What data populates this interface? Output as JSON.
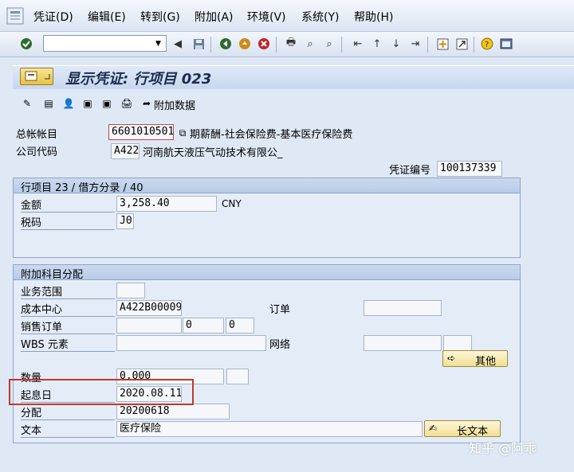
{
  "menu": {
    "items": [
      "凭证(D)",
      "编辑(E)",
      "转到(G)",
      "附加(A)",
      "环境(V)",
      "系统(Y)",
      "帮助(H)"
    ]
  },
  "toolbar": {
    "command_field": "",
    "icons": [
      "enter-icon",
      "back-icon",
      "exit-icon",
      "cancel-icon",
      "print-icon",
      "find-icon",
      "find-next-icon",
      "first-page-icon",
      "previous-page-icon",
      "next-page-icon",
      "last-page-icon",
      "create-session-icon",
      "shortcut-icon",
      "help-icon",
      "layout-icon"
    ]
  },
  "title": "显示凭证: 行项目 023",
  "app_toolbar": {
    "extra_data_label": "附加数据"
  },
  "header": {
    "gl_account_label": "总帐帐目",
    "gl_account_value": "6601010501",
    "gl_account_desc": "期薪酬-社会保险费-基本医疗保险费",
    "company_code_label": "公司代码",
    "company_code_value": "A422",
    "company_name": "河南航天液压气动技术有限公_",
    "doc_number_label": "凭证编号",
    "doc_number_value": "100137339"
  },
  "line_item": {
    "title": "行项目 23 / 借方分录 / 40",
    "amount_label": "金额",
    "amount_value": "3,258.40",
    "currency": "CNY",
    "tax_code_label": "税码",
    "tax_code_value": "J0"
  },
  "assignment": {
    "title": "附加科目分配",
    "business_area_label": "业务范围",
    "business_area_value": "",
    "cost_center_label": "成本中心",
    "cost_center_value": "A422B00009",
    "order_label": "订单",
    "order_value": "",
    "sales_order_label": "销售订单",
    "sales_order_value": "",
    "sales_order_item": "0",
    "sales_order_schedule": "0",
    "wbs_label": "WBS 元素",
    "wbs_value": "",
    "network_label": "网络",
    "network_value": "",
    "network_op": "",
    "more_button": "其他",
    "quantity_label": "数量",
    "quantity_value": "0.000",
    "quantity_unit": "",
    "value_date_label": "起息日",
    "value_date_value": "2020.08.11",
    "assignment_label": "分配",
    "assignment_value": "20200618",
    "text_label": "文本",
    "text_value": "医疗保险",
    "long_text_button": "长文本"
  },
  "watermark": "知乎 @阿乖",
  "colors": {
    "highlight": "#c0392b",
    "button_bg": "#f1df92",
    "background": "#dfe8f5"
  }
}
